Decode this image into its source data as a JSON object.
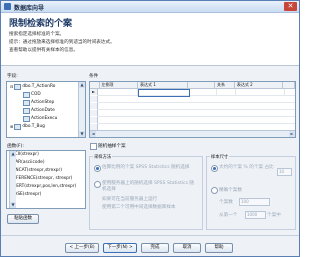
{
  "window": {
    "title": "数据库向导",
    "close_glyph": "✕"
  },
  "header": {
    "title": "限制检索的个案",
    "line1": "搜索指定选择标准的个案。",
    "line2": "提示：通过拖放来选择标准的到适当的时间表达式。",
    "line3": "查看帮助以提供有关样本的信息。"
  },
  "fields_label": "字段:",
  "tree": [
    {
      "label": "dbo.T_ActionRo",
      "kind": "table",
      "expanded": true
    },
    {
      "label": "COD",
      "kind": "field"
    },
    {
      "label": "ActionStep",
      "kind": "field"
    },
    {
      "label": "ActionDate",
      "kind": "field"
    },
    {
      "label": "ActionExecu",
      "kind": "field"
    },
    {
      "label": "dbo.T_Bug",
      "kind": "table",
      "expanded": false
    }
  ],
  "conditions_label": "条件",
  "grid": {
    "headers": [
      "",
      "左侧项",
      "表达式 1",
      "",
      "关系",
      "表达式 2",
      ""
    ],
    "rows": 7,
    "active_row": 0
  },
  "functions_label": "函数(F):",
  "functions": [
    "ASCII(strexpr)",
    "CHAR(asciicode)",
    "CONCAT(strexpr,strexpr)",
    "DIFFERENCE(strexpr, strexpr)",
    "INSERT(strexpr,pos,len,strexpr)",
    "LCASE(strexpr)"
  ],
  "paste_button": "粘贴函数",
  "sample": {
    "checkbox_label": "随机抽样个案",
    "method_group": "采样方法",
    "method_option1": "估算比例的个案 SPSS Statistics 随机选择",
    "method_option2": "使用服务器上的随机选择 SPSS Statistics 随机选择",
    "method_note": "如果可在当前服务器上运行",
    "method_note2": "使用第二个可用中间选择数据库样本",
    "size_group": "样本尺寸",
    "size_option1": "大约的个案 % 的个案 占比",
    "size_pct_value": "10",
    "size_option2": "精确个案数",
    "size_count_label": "个案数",
    "size_count_value": "100",
    "size_from_label": "从第一个",
    "size_from_value": "1000",
    "size_from_suffix": "个案中"
  },
  "footer": {
    "back": "< 上一步(B)",
    "next": "下一步(N) >",
    "finish": "完成",
    "cancel": "取消",
    "help": "帮助"
  },
  "colors": {
    "accent": "#3b6fb6",
    "header_text": "#1e3a66",
    "window_border": "#5a7fb3"
  }
}
